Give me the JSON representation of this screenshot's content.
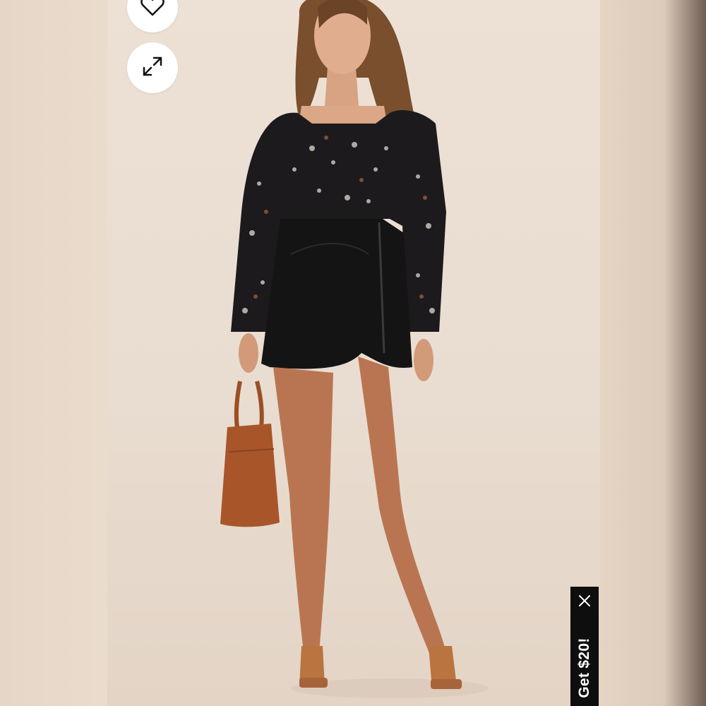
{
  "product_gallery": {
    "favorite_icon": "heart-outline-icon",
    "expand_icon": "expand-arrows-icon",
    "image_subject": "product-photo"
  },
  "promo_tab": {
    "label": "Get $20!",
    "close_icon": "close-icon"
  },
  "colors": {
    "background": "#ece0d4",
    "button": "#ffffff",
    "promo_bg": "#0e0e0e",
    "promo_text": "#ffffff"
  }
}
